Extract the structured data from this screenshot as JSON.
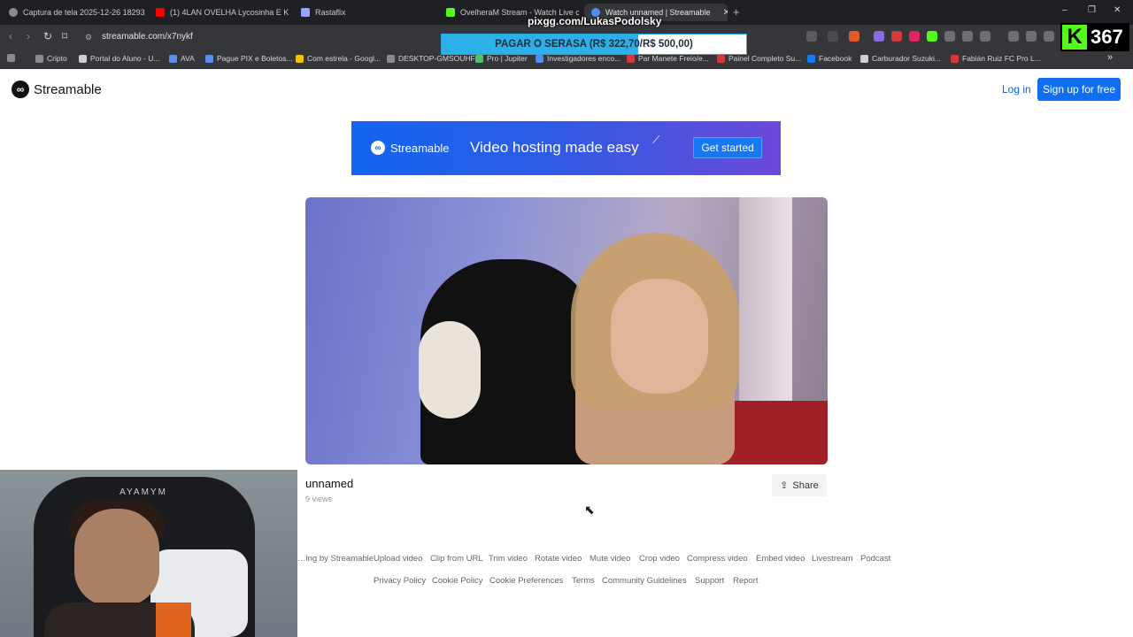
{
  "browser": {
    "tabs": [
      {
        "label": "Captura de tela 2025-12-26 182933...",
        "color": "#8a8b90"
      },
      {
        "label": "(1) 4LAN OVELHA Lycosinha E KIKIR...",
        "color": "#ff0000"
      },
      {
        "label": "Rastaflix",
        "color": "#9aa3ff"
      },
      {
        "label": "OvelheraM Stream - Watch Live on K...",
        "color": "#53fc18"
      },
      {
        "label": "Watch unnamed | Streamable",
        "color": "#4f8ef7"
      }
    ],
    "new_tab": "+",
    "window_controls": [
      "–",
      "❐",
      "✕"
    ],
    "url": "streamable.com/x7nykf",
    "bookmarks": [
      {
        "label": "Cripto",
        "color": "#8a8b90"
      },
      {
        "label": "Portal do Aluno - U...",
        "color": "#cfcfcf"
      },
      {
        "label": "AVA",
        "color": "#5b8def"
      },
      {
        "label": "Pague PIX e Boletos...",
        "color": "#5b8def"
      },
      {
        "label": "Com estrela - Googl...",
        "color": "#f2c200"
      },
      {
        "label": "DESKTOP-GMSOUHF",
        "color": "#8a8b90"
      },
      {
        "label": "Pro | Jupiter",
        "color": "#4cc46a"
      },
      {
        "label": "Investigadores enco...",
        "color": "#4f8ef7"
      },
      {
        "label": "Par Manete Freio/e...",
        "color": "#d23b3b"
      },
      {
        "label": "Painel Completo Su...",
        "color": "#d23b3b"
      },
      {
        "label": "Facebook",
        "color": "#1877f2"
      },
      {
        "label": "Carburador Suzuki...",
        "color": "#cfcfcf"
      },
      {
        "label": "Fabián Ruiz FC Pro L...",
        "color": "#d23b3b"
      }
    ],
    "more": "»"
  },
  "overlay": {
    "pix_text": "pixgg.com/LukasPodolsky",
    "goal_text": "PAGAR O SERASA (R$ 322,70/R$ 500,00)",
    "goal_progress": 0.6454,
    "kick_logo": "K",
    "kick_viewers": "367"
  },
  "site": {
    "logo_mark": "∞",
    "logo_text": "Streamable",
    "login_label": "Log in",
    "signup_label": "Sign up for free",
    "banner": {
      "logo_text": "Streamable",
      "tagline": "Video hosting made easy",
      "cta": "Get started"
    },
    "video": {
      "title": "unnamed",
      "views": "9 views",
      "share_label": "Share"
    },
    "footer_row1": [
      "…ing by Streamable",
      "Upload video",
      "Clip from URL",
      "Trim video",
      "Rotate video",
      "Mute video",
      "Crop video",
      "Compress video",
      "Embed video",
      "Livestream",
      "Podcast"
    ],
    "footer_row2": [
      "Privacy Policy",
      "Cookie Policy",
      "Cookie Preferences",
      "Terms",
      "Community Guidelines",
      "Support",
      "Report"
    ]
  },
  "webcam": {
    "chair_brand": "AYAMYM"
  }
}
